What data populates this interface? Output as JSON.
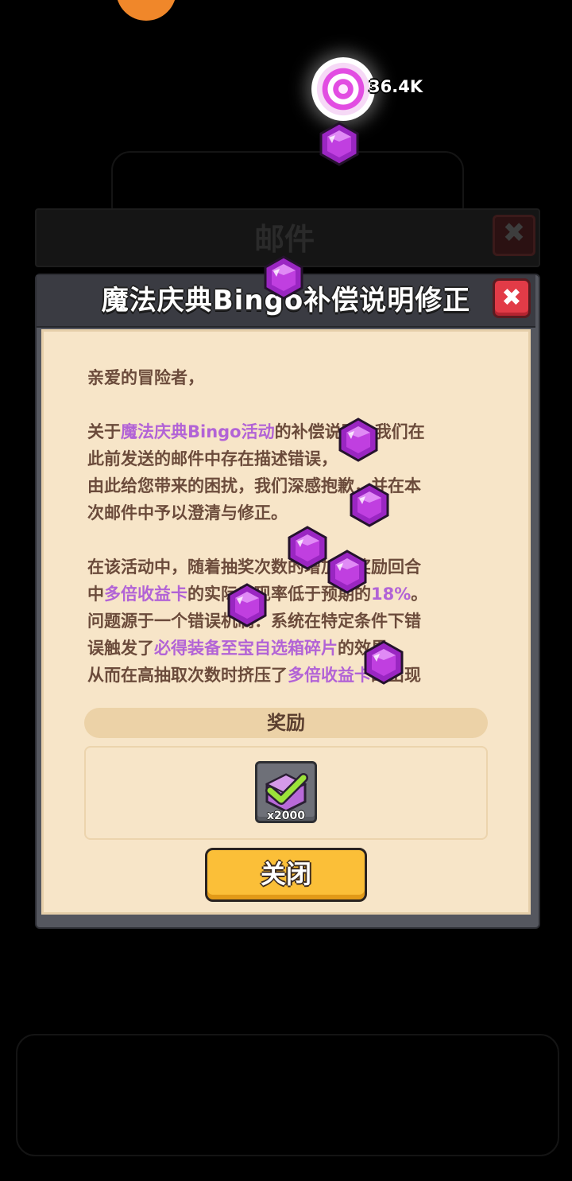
{
  "currency": {
    "value": "36.4K",
    "icon": "magic-portal-icon"
  },
  "back_panel": {
    "title": "邮件",
    "close_symbol": "✖"
  },
  "dialog": {
    "title": "魔法庆典Bingo补偿说明修正",
    "close_symbol": "✖",
    "body": {
      "greeting": "亲爱的冒险者，",
      "p1": [
        [
          {
            "t": "关于"
          },
          {
            "t": "魔法庆典Bingo活动",
            "hl": true
          },
          {
            "t": "的补偿说明，我们在"
          }
        ],
        [
          {
            "t": "此前发送的邮件中存在描述错误，"
          }
        ],
        [
          {
            "t": "由此给您带来的困扰，我们深感抱歉，并在本"
          }
        ],
        [
          {
            "t": "次邮件中予以澄清与修正。"
          }
        ]
      ],
      "p2": [
        [
          {
            "t": "在该活动中，随着抽奖次数的增加，奖励回合"
          }
        ],
        [
          {
            "t": "中"
          },
          {
            "t": "多倍收益卡",
            "hl": true
          },
          {
            "t": "的实际出现率低于预期的"
          },
          {
            "t": "18%",
            "hl": true
          },
          {
            "t": "。"
          }
        ],
        [
          {
            "t": "问题源于一个错误机制：系统在特定条件下错"
          }
        ],
        [
          {
            "t": "误触发了"
          },
          {
            "t": "必得装备至宝自选箱碎片",
            "hl": true
          },
          {
            "t": "的效果，"
          }
        ],
        [
          {
            "t": "从而在高抽取次数时挤压了"
          },
          {
            "t": "多倍收益卡",
            "hl": true
          },
          {
            "t": "的出现"
          }
        ]
      ]
    },
    "reward_label": "奖励",
    "reward_item": {
      "icon": "equipment-chest-icon",
      "quantity": "x2000"
    },
    "close_button_label": "关闭"
  },
  "colors": {
    "paper": "#f7e5c8",
    "text": "#6b4b3b",
    "highlight": "#b263d6",
    "button": "#fbbf38",
    "close": "#e23b47",
    "gem": "#c03fe0"
  }
}
